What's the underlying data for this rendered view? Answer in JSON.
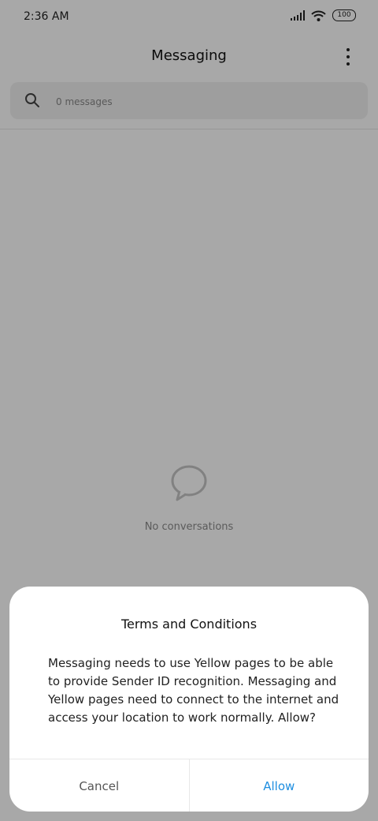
{
  "status_bar": {
    "time": "2:36 AM",
    "battery": "100"
  },
  "app_bar": {
    "title": "Messaging"
  },
  "search": {
    "placeholder": "0 messages"
  },
  "empty_state": {
    "text": "No conversations"
  },
  "dialog": {
    "title": "Terms and Conditions",
    "body": "Messaging needs to use Yellow pages to be able to provide Sender ID recognition. Messaging and Yellow pages need to connect to the internet and access your location to work normally. Allow?",
    "cancel_label": "Cancel",
    "allow_label": "Allow"
  },
  "colors": {
    "accent": "#1e8ee0",
    "scrim": "rgba(0,0,0,0.34)"
  },
  "icons": [
    "signal-icon",
    "wifi-icon",
    "battery-icon",
    "more-options-icon",
    "search-icon",
    "chat-bubble-icon"
  ]
}
